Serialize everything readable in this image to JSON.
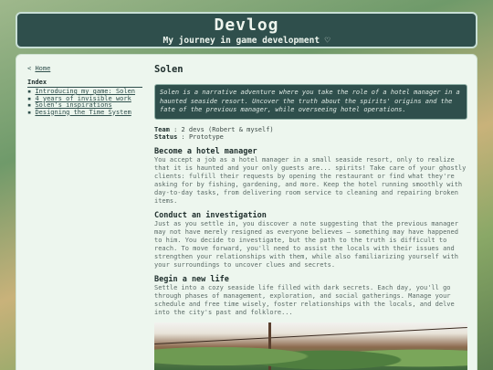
{
  "site": {
    "title": "Devlog",
    "subtitle": "My journey in game development",
    "subtitle_icon": "heart-icon",
    "subtitle_glyph": "♡"
  },
  "sidebar": {
    "home_arrow": "<",
    "home_label": "Home",
    "index_title": "Index",
    "bullet": "▪",
    "items": [
      {
        "label": "Introducing my game: Solen"
      },
      {
        "label": "4 years of invisible work"
      },
      {
        "label": "Solen's inspirations"
      },
      {
        "label": "Designing the Time System"
      }
    ]
  },
  "post": {
    "title": "Solen",
    "summary": "Solen is a narrative adventure where you take the role of a hotel manager in a haunted seaside resort. Uncover the truth about the spirits' origins and the fate of the previous manager, while overseeing hotel operations.",
    "team_label": "Team",
    "team_value": ": 2 devs (Robert & myself)",
    "status_label": "Status",
    "status_value": ": Prototype",
    "sections": [
      {
        "title": "Become a hotel manager",
        "text": "You accept a job as a hotel manager in a small seaside resort, only to realize that it is haunted and your only guests are... spirits! Take care of your ghostly clients: fulfill their requests by opening the restaurant or find what they're asking for by fishing, gardening, and more. Keep the hotel running smoothly with day-to-day tasks, from delivering room service to cleaning and repairing broken items."
      },
      {
        "title": "Conduct an investigation",
        "text": "Just as you settle in, you discover a note suggesting that the previous manager may not have merely resigned as everyone believes — something may have happened to him. You decide to investigate, but the path to the truth is difficult to reach. To move forward, you'll need to assist the locals with their issues and strengthen your relationships with them, while also familiarizing yourself with your surroundings to uncover clues and secrets."
      },
      {
        "title": "Begin a new life",
        "text": "Settle into a cozy seaside life filled with dark secrets. Each day, you'll go through phases of management, exploration, and social gatherings. Manage your schedule and free time wisely, foster relationships with the locals, and delve into the city's past and folklore..."
      }
    ]
  }
}
